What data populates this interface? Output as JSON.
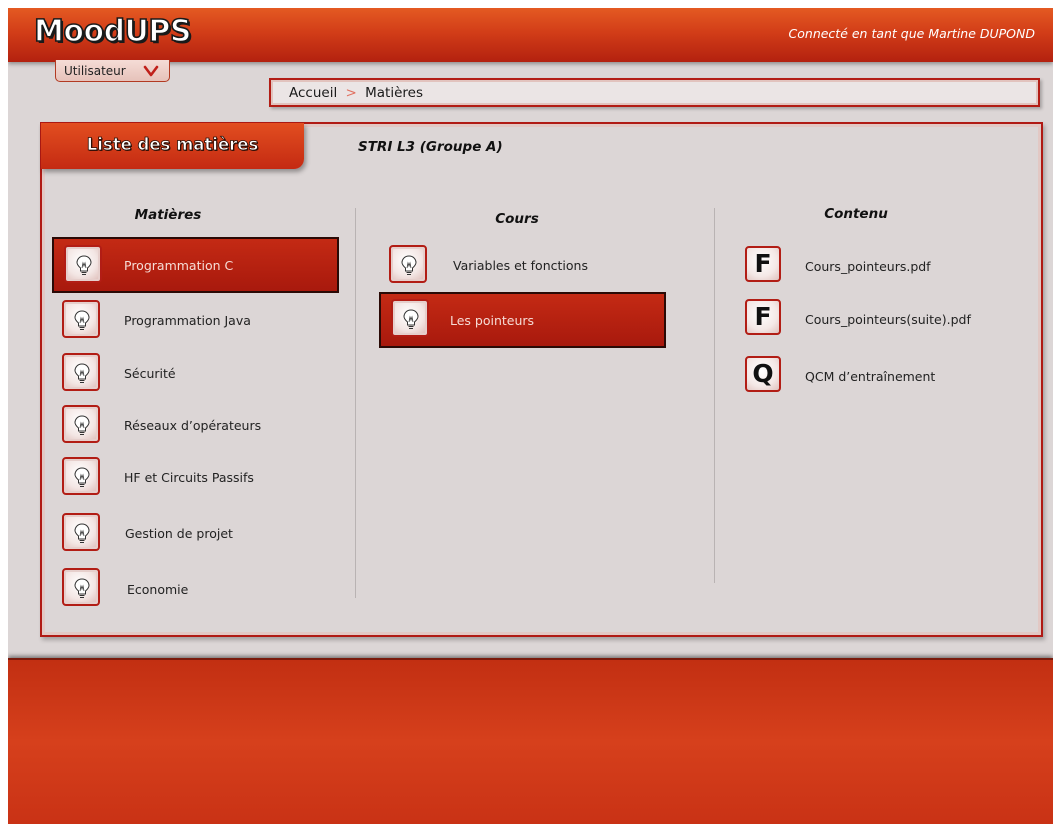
{
  "app": {
    "logo": "MoodUPS",
    "connected_as": "Connecté en tant que Martine DUPOND"
  },
  "user_menu": {
    "label": "Utilisateur"
  },
  "breadcrumb": {
    "home": "Accueil",
    "separator": ">",
    "current": "Matières"
  },
  "panel": {
    "tab_label": "Liste des matières",
    "group": "STRI L3 (Groupe A)"
  },
  "columns": {
    "subjects": {
      "header": "Matières",
      "items": [
        {
          "label": "Programmation C",
          "selected": true,
          "icon": "lightbulb-icon"
        },
        {
          "label": "Programmation Java",
          "selected": false,
          "icon": "lightbulb-icon"
        },
        {
          "label": "Sécurité",
          "selected": false,
          "icon": "lightbulb-icon"
        },
        {
          "label": "Réseaux d’opérateurs",
          "selected": false,
          "icon": "lightbulb-icon"
        },
        {
          "label": "HF et Circuits Passifs",
          "selected": false,
          "icon": "lightbulb-icon"
        },
        {
          "label": "Gestion de projet",
          "selected": false,
          "icon": "lightbulb-icon"
        },
        {
          "label": "Economie",
          "selected": false,
          "icon": "lightbulb-icon"
        }
      ]
    },
    "courses": {
      "header": "Cours",
      "items": [
        {
          "label": "Variables et fonctions",
          "selected": false,
          "icon": "lightbulb-icon"
        },
        {
          "label": "Les pointeurs",
          "selected": true,
          "icon": "lightbulb-icon"
        }
      ]
    },
    "content": {
      "header": "Contenu",
      "items": [
        {
          "label": "Cours_pointeurs.pdf",
          "badge": "F",
          "icon": "file-icon"
        },
        {
          "label": "Cours_pointeurs(suite).pdf",
          "badge": "F",
          "icon": "file-icon"
        },
        {
          "label": "QCM d’entraînement",
          "badge": "Q",
          "icon": "quiz-icon"
        }
      ]
    }
  },
  "colors": {
    "accent": "#c42a12",
    "panel_border": "#b01a14",
    "background": "#dcd6d6"
  }
}
